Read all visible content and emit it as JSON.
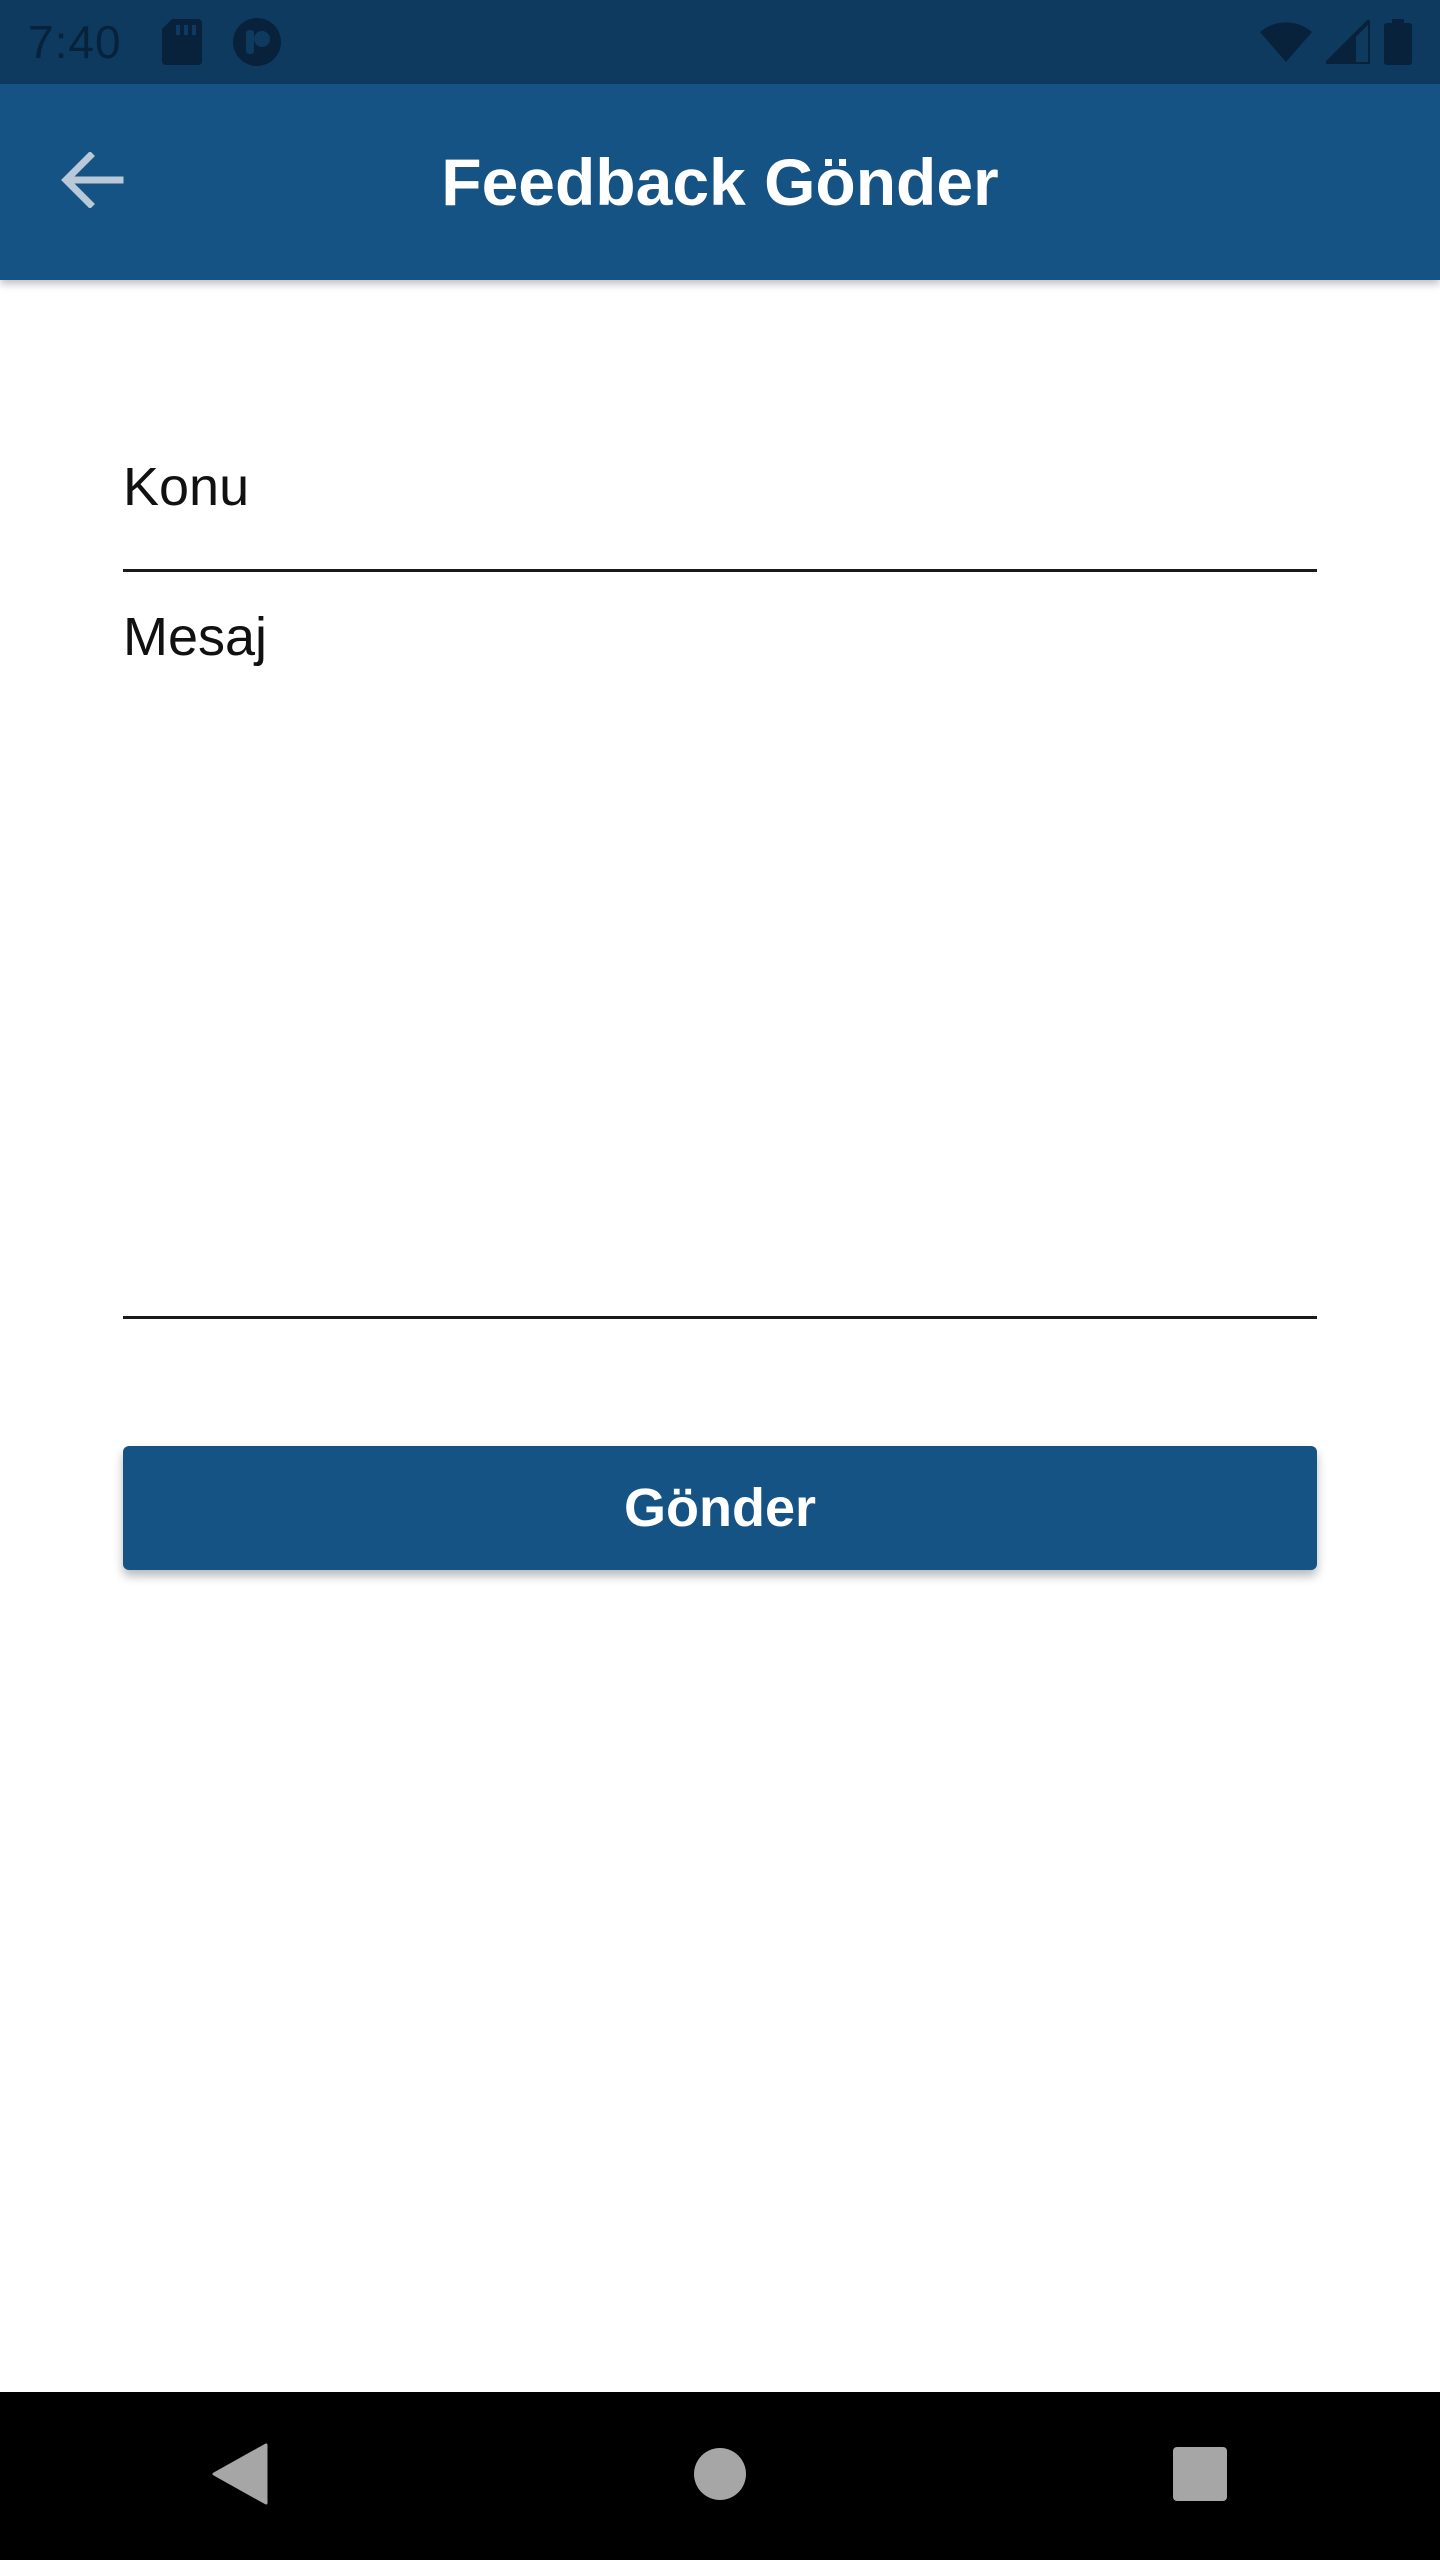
{
  "status_bar": {
    "time": "7:40",
    "icons_left": [
      "sd-card-icon",
      "app-notification-icon"
    ],
    "icons_right": [
      "wifi-icon",
      "cell-signal-icon",
      "battery-icon"
    ]
  },
  "app_bar": {
    "title": "Feedback Gönder",
    "back_icon": "arrow-back-icon"
  },
  "form": {
    "subject_label": "Konu",
    "message_label": "Mesaj",
    "submit_label": "Gönder"
  },
  "nav_bar": {
    "icons": [
      "back-triangle-icon",
      "home-circle-icon",
      "recents-square-icon"
    ]
  },
  "colors": {
    "status_bar": "#0f3a60",
    "primary": "#155384",
    "nav_bar": "#000000"
  }
}
